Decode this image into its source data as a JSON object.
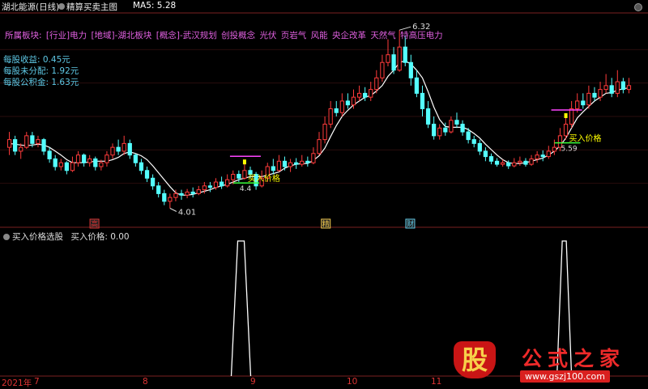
{
  "header": {
    "stock_name": "湖北能源(日线)",
    "indicator_name": "精算买卖主图",
    "ma_label": "MA5: 5.28",
    "close_icon": "close-icon"
  },
  "sectors": {
    "label": "所属板块:",
    "items": [
      "[行业]电力",
      "[地域]-湖北板块",
      "[概念]-武汉规划",
      "创投概念",
      "光伏",
      "页岩气",
      "风能",
      "央企改革",
      "天然气",
      "特高压电力"
    ]
  },
  "stats": {
    "eps": "每股收益: 0.45元",
    "undistributed": "每股未分配: 1.92元",
    "reserve": "每股公积金: 1.63元"
  },
  "annotations": {
    "high": "6.32",
    "low": "4.01",
    "buy_label_1": "买入价格",
    "buy_label_2": "买入价格",
    "buy_price_1": "4.4",
    "buy_price_2": "5.59",
    "event_1": "高",
    "event_2": "精",
    "event_3": "财"
  },
  "subpane": {
    "title": "买入价格选股",
    "value_label": "买入价格: 0.00"
  },
  "x_axis": {
    "year": "2021年",
    "months": [
      "7",
      "8",
      "9",
      "10",
      "11"
    ]
  },
  "watermark": {
    "badge": "股",
    "name": "公式之家",
    "url": "www.gszj100.com"
  },
  "colors": {
    "up": "#ff3b3b",
    "down": "#54ffff",
    "ma": "#ffffff",
    "buy_marker": "#ffff00",
    "buy_line": "#3aff3a",
    "resistance_line": "#ff44ff",
    "sector_text": "#e060e0",
    "stat_text": "#5fc9e6"
  },
  "chart_data": [
    {
      "type": "candlestick",
      "title": "湖北能源(日线)",
      "ylim": [
        3.9,
        6.5
      ],
      "candles": [
        [
          4.8,
          4.9,
          5.0,
          4.7
        ],
        [
          4.9,
          4.75,
          4.95,
          4.7
        ],
        [
          4.75,
          4.8,
          4.85,
          4.65
        ],
        [
          4.8,
          4.95,
          5.0,
          4.78
        ],
        [
          4.95,
          4.85,
          5.0,
          4.8
        ],
        [
          4.85,
          4.9,
          4.95,
          4.8
        ],
        [
          4.9,
          4.75,
          4.92,
          4.7
        ],
        [
          4.75,
          4.65,
          4.8,
          4.6
        ],
        [
          4.65,
          4.55,
          4.7,
          4.5
        ],
        [
          4.55,
          4.6,
          4.65,
          4.5
        ],
        [
          4.6,
          4.5,
          4.62,
          4.45
        ],
        [
          4.5,
          4.6,
          4.68,
          4.48
        ],
        [
          4.6,
          4.7,
          4.75,
          4.55
        ],
        [
          4.7,
          4.6,
          4.72,
          4.55
        ],
        [
          4.6,
          4.65,
          4.7,
          4.55
        ],
        [
          4.65,
          4.55,
          4.68,
          4.5
        ],
        [
          4.55,
          4.6,
          4.64,
          4.5
        ],
        [
          4.6,
          4.7,
          4.75,
          4.55
        ],
        [
          4.7,
          4.8,
          4.85,
          4.65
        ],
        [
          4.8,
          4.75,
          4.9,
          4.7
        ],
        [
          4.75,
          4.85,
          4.95,
          4.7
        ],
        [
          4.85,
          4.7,
          4.9,
          4.65
        ],
        [
          4.7,
          4.6,
          4.72,
          4.55
        ],
        [
          4.6,
          4.5,
          4.65,
          4.45
        ],
        [
          4.5,
          4.4,
          4.55,
          4.35
        ],
        [
          4.4,
          4.3,
          4.45,
          4.25
        ],
        [
          4.3,
          4.2,
          4.35,
          4.15
        ],
        [
          4.2,
          4.1,
          4.25,
          4.05
        ],
        [
          4.1,
          4.15,
          4.2,
          4.01
        ],
        [
          4.15,
          4.2,
          4.25,
          4.1
        ],
        [
          4.2,
          4.18,
          4.25,
          4.12
        ],
        [
          4.18,
          4.22,
          4.26,
          4.14
        ],
        [
          4.22,
          4.2,
          4.28,
          4.15
        ],
        [
          4.2,
          4.25,
          4.3,
          4.18
        ],
        [
          4.25,
          4.3,
          4.35,
          4.2
        ],
        [
          4.3,
          4.28,
          4.35,
          4.22
        ],
        [
          4.28,
          4.35,
          4.4,
          4.25
        ],
        [
          4.35,
          4.3,
          4.42,
          4.26
        ],
        [
          4.3,
          4.38,
          4.45,
          4.28
        ],
        [
          4.38,
          4.45,
          4.5,
          4.32
        ],
        [
          4.45,
          4.4,
          4.5,
          4.35
        ],
        [
          4.4,
          4.5,
          4.6,
          4.38
        ],
        [
          4.5,
          4.45,
          4.55,
          4.4
        ],
        [
          4.45,
          4.3,
          4.48,
          4.25
        ],
        [
          4.3,
          4.4,
          4.5,
          4.28
        ],
        [
          4.4,
          4.55,
          4.6,
          4.35
        ],
        [
          4.55,
          4.5,
          4.65,
          4.45
        ],
        [
          4.5,
          4.62,
          4.7,
          4.48
        ],
        [
          4.62,
          4.55,
          4.68,
          4.5
        ],
        [
          4.55,
          4.6,
          4.65,
          4.48
        ],
        [
          4.6,
          4.58,
          4.66,
          4.52
        ],
        [
          4.58,
          4.62,
          4.7,
          4.55
        ],
        [
          4.62,
          4.6,
          4.68,
          4.55
        ],
        [
          4.6,
          4.72,
          4.8,
          4.58
        ],
        [
          4.72,
          4.9,
          5.0,
          4.7
        ],
        [
          4.9,
          5.1,
          5.2,
          4.85
        ],
        [
          5.1,
          5.3,
          5.4,
          5.05
        ],
        [
          5.3,
          5.25,
          5.4,
          5.2
        ],
        [
          5.25,
          5.4,
          5.5,
          5.2
        ],
        [
          5.4,
          5.35,
          5.5,
          5.3
        ],
        [
          5.35,
          5.45,
          5.55,
          5.3
        ],
        [
          5.45,
          5.5,
          5.6,
          5.4
        ],
        [
          5.5,
          5.45,
          5.58,
          5.4
        ],
        [
          5.45,
          5.55,
          5.65,
          5.4
        ],
        [
          5.55,
          5.7,
          5.8,
          5.5
        ],
        [
          5.7,
          5.9,
          6.0,
          5.65
        ],
        [
          5.9,
          6.0,
          6.2,
          5.85
        ],
        [
          6.0,
          5.8,
          6.1,
          5.75
        ],
        [
          5.8,
          6.1,
          6.32,
          5.78
        ],
        [
          6.1,
          5.9,
          6.25,
          5.85
        ],
        [
          5.9,
          5.7,
          6.0,
          5.6
        ],
        [
          5.7,
          5.5,
          5.8,
          5.45
        ],
        [
          5.5,
          5.3,
          5.6,
          5.2
        ],
        [
          5.3,
          5.1,
          5.4,
          5.05
        ],
        [
          5.1,
          4.95,
          5.2,
          4.9
        ],
        [
          4.95,
          5.05,
          5.1,
          4.9
        ],
        [
          5.05,
          5.0,
          5.12,
          4.95
        ],
        [
          5.0,
          5.15,
          5.2,
          4.98
        ],
        [
          5.15,
          5.1,
          5.25,
          5.05
        ],
        [
          5.1,
          5.0,
          5.15,
          4.95
        ],
        [
          5.0,
          4.9,
          5.05,
          4.85
        ],
        [
          4.9,
          4.85,
          4.95,
          4.8
        ],
        [
          4.85,
          4.75,
          4.9,
          4.7
        ],
        [
          4.75,
          4.68,
          4.8,
          4.62
        ],
        [
          4.68,
          4.62,
          4.72,
          4.58
        ],
        [
          4.62,
          4.58,
          4.66,
          4.55
        ],
        [
          4.58,
          4.6,
          4.64,
          4.55
        ],
        [
          4.6,
          4.56,
          4.63,
          4.52
        ],
        [
          4.56,
          4.6,
          4.66,
          4.54
        ],
        [
          4.6,
          4.62,
          4.68,
          4.56
        ],
        [
          4.62,
          4.58,
          4.66,
          4.55
        ],
        [
          4.58,
          4.65,
          4.7,
          4.56
        ],
        [
          4.65,
          4.7,
          4.75,
          4.6
        ],
        [
          4.7,
          4.68,
          4.76,
          4.62
        ],
        [
          4.68,
          4.75,
          4.82,
          4.65
        ],
        [
          4.75,
          4.8,
          4.9,
          4.7
        ],
        [
          4.8,
          4.95,
          5.05,
          4.75
        ],
        [
          4.95,
          5.1,
          5.2,
          4.9
        ],
        [
          5.1,
          5.3,
          5.4,
          5.05
        ],
        [
          5.3,
          5.4,
          5.5,
          5.25
        ],
        [
          5.4,
          5.35,
          5.5,
          5.3
        ],
        [
          5.35,
          5.5,
          5.6,
          5.3
        ],
        [
          5.5,
          5.45,
          5.58,
          5.4
        ],
        [
          5.45,
          5.55,
          5.65,
          5.4
        ],
        [
          5.55,
          5.6,
          5.75,
          5.5
        ],
        [
          5.6,
          5.5,
          5.7,
          5.45
        ],
        [
          5.5,
          5.65,
          5.8,
          5.45
        ],
        [
          5.65,
          5.55,
          5.7,
          5.5
        ],
        [
          5.55,
          5.6,
          5.7,
          5.5
        ]
      ],
      "ma5": [
        4.85,
        4.84,
        4.83,
        4.82,
        4.83,
        4.84,
        4.83,
        4.8,
        4.75,
        4.7,
        4.64,
        4.6,
        4.6,
        4.6,
        4.61,
        4.62,
        4.62,
        4.62,
        4.64,
        4.67,
        4.72,
        4.74,
        4.72,
        4.69,
        4.64,
        4.56,
        4.47,
        4.38,
        4.29,
        4.21,
        4.18,
        4.18,
        4.19,
        4.21,
        4.23,
        4.25,
        4.28,
        4.3,
        4.32,
        4.35,
        4.38,
        4.4,
        4.42,
        4.42,
        4.42,
        4.44,
        4.46,
        4.48,
        4.53,
        4.56,
        4.58,
        4.59,
        4.59,
        4.63,
        4.69,
        4.79,
        4.94,
        5.08,
        5.2,
        5.28,
        5.35,
        5.4,
        5.45,
        5.47,
        5.53,
        5.6,
        5.72,
        5.8,
        5.9,
        5.92,
        5.88,
        5.8,
        5.7,
        5.52,
        5.32,
        5.16,
        5.07,
        5.06,
        5.06,
        5.06,
        5.03,
        4.98,
        4.92,
        4.84,
        4.77,
        4.7,
        4.64,
        4.6,
        4.59,
        4.59,
        4.6,
        4.62,
        4.64,
        4.66,
        4.7,
        4.75,
        4.82,
        4.92,
        5.05,
        5.18,
        5.26,
        5.33,
        5.4,
        5.45,
        5.5,
        5.51,
        5.54,
        5.56,
        5.57
      ]
    },
    {
      "type": "line",
      "title": "买入价格选股",
      "series": [
        {
          "name": "买入价格",
          "spike_positions": [
            0.375,
            0.892
          ],
          "values": [
            1,
            1
          ]
        }
      ],
      "ylim": [
        0,
        1
      ]
    }
  ]
}
